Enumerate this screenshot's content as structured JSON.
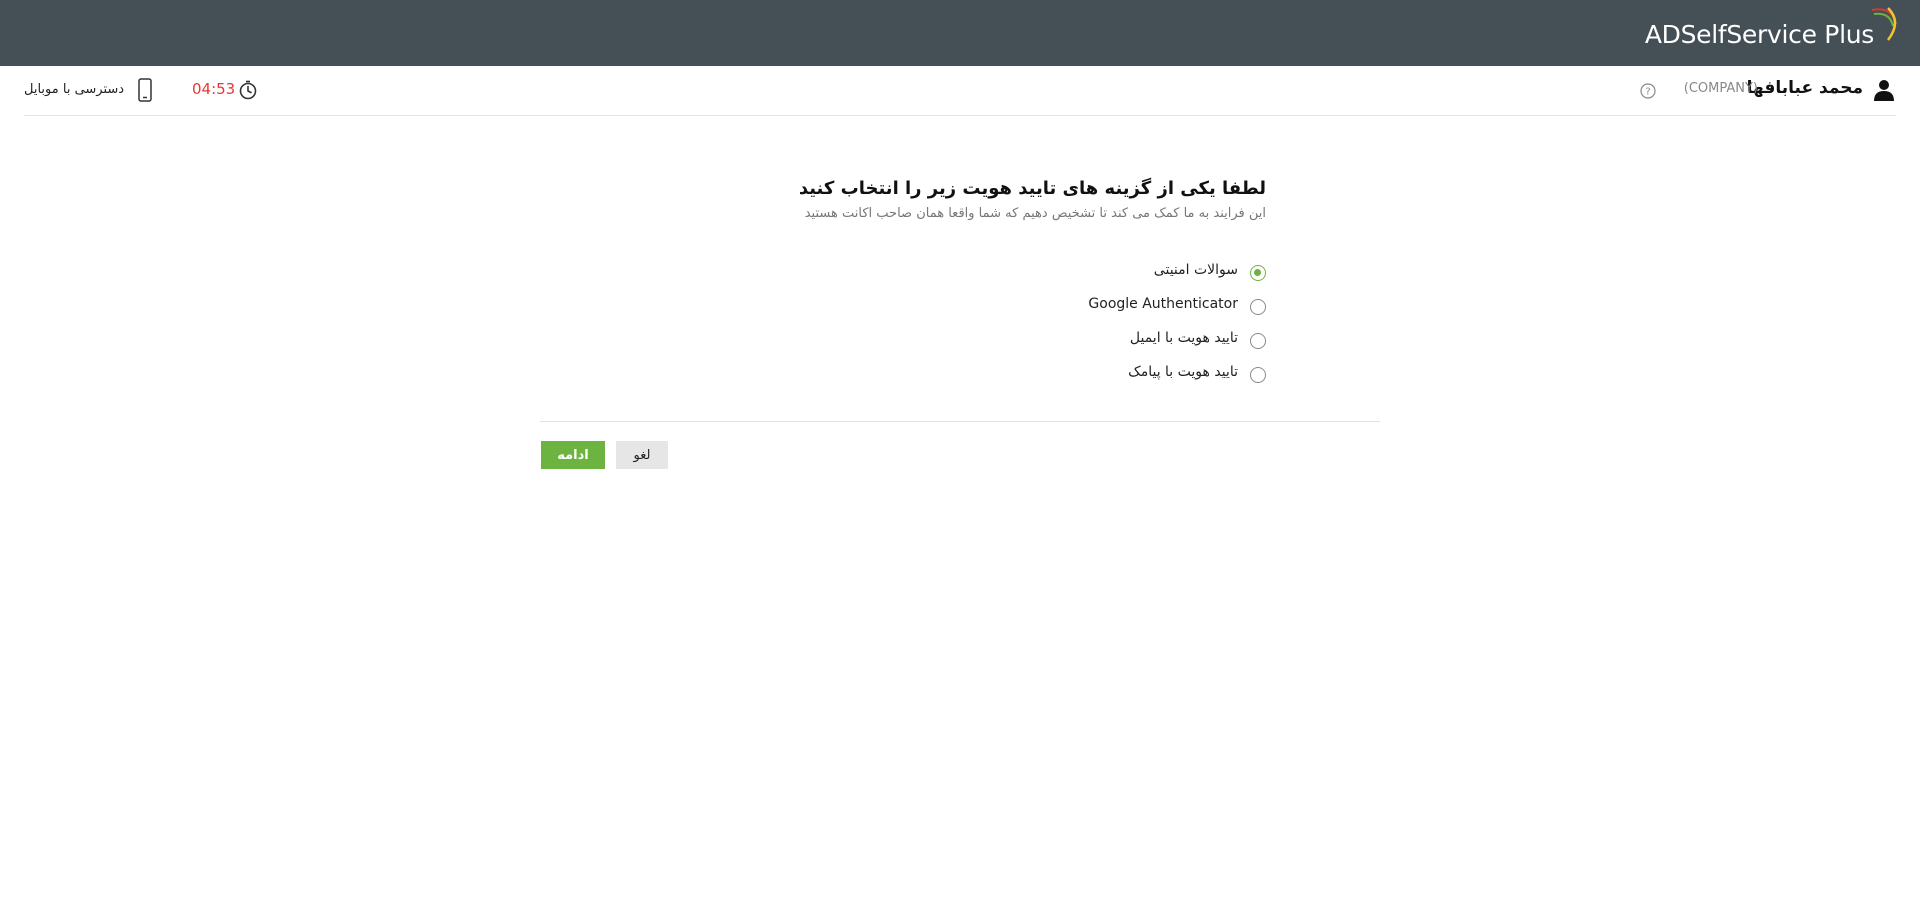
{
  "app": {
    "brand": "ADSelfService Plus",
    "colors": {
      "topbar": "#454f56",
      "accent": "#6db33f",
      "timer": "#e53935"
    }
  },
  "header": {
    "user_name": "محمد عبابافها",
    "user_domain": "(COMPANY)",
    "help_icon": "question-circle-icon",
    "timer": "04:53",
    "timer_icon": "stopwatch-icon",
    "mobile_label": "دسترسی با موبایل",
    "mobile_icon": "mobile-phone-icon",
    "user_icon": "user-icon"
  },
  "main": {
    "title": "لطفا یکی از گزینه های تایید هویت زیر را انتخاب کنید",
    "subtitle": "این فرایند به ما کمک می کند تا تشخیص دهیم که شما واقعا همان صاحب اکانت هستید",
    "options": [
      {
        "label": "سوالات امنیتی",
        "selected": true
      },
      {
        "label": "Google Authenticator",
        "selected": false
      },
      {
        "label": "تایید هویت با ایمیل",
        "selected": false
      },
      {
        "label": "تایید هویت با پیامک",
        "selected": false
      }
    ],
    "continue_label": "ادامه",
    "cancel_label": "لغو"
  }
}
